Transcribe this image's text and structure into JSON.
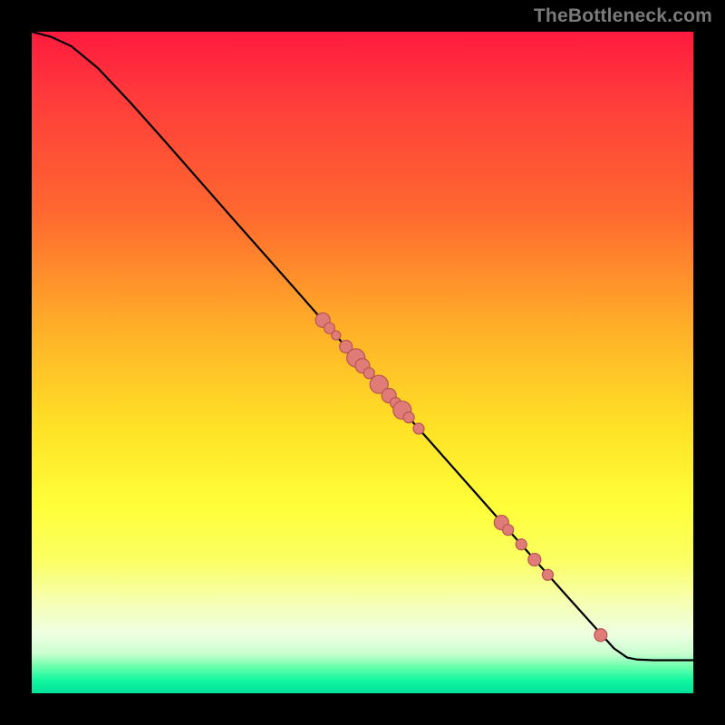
{
  "watermark": {
    "text": "TheBottleneck.com"
  },
  "colors": {
    "dot_fill": "#e07c78",
    "dot_stroke": "#b85550",
    "curve": "#000000",
    "frame_bg": "#000000"
  },
  "chart_data": {
    "type": "line",
    "title": "",
    "xlabel": "",
    "ylabel": "",
    "xlim": [
      0,
      100
    ],
    "ylim": [
      0,
      100
    ],
    "grid": false,
    "curve": [
      {
        "x": 0,
        "y": 100
      },
      {
        "x": 3,
        "y": 99.2
      },
      {
        "x": 6,
        "y": 97.8
      },
      {
        "x": 10,
        "y": 94.5
      },
      {
        "x": 15,
        "y": 89.2
      },
      {
        "x": 20,
        "y": 83.6
      },
      {
        "x": 30,
        "y": 72.2
      },
      {
        "x": 40,
        "y": 60.9
      },
      {
        "x": 50,
        "y": 49.5
      },
      {
        "x": 60,
        "y": 38.3
      },
      {
        "x": 70,
        "y": 27.0
      },
      {
        "x": 80,
        "y": 15.7
      },
      {
        "x": 88,
        "y": 6.8
      },
      {
        "x": 90,
        "y": 5.4
      },
      {
        "x": 91.5,
        "y": 5.1
      },
      {
        "x": 94,
        "y": 5.0
      },
      {
        "x": 100,
        "y": 5.0
      }
    ],
    "points": [
      {
        "x": 44.0,
        "y": 56.4,
        "r": 8
      },
      {
        "x": 45.0,
        "y": 55.2,
        "r": 6
      },
      {
        "x": 46.0,
        "y": 54.1,
        "r": 5
      },
      {
        "x": 47.5,
        "y": 52.4,
        "r": 7
      },
      {
        "x": 49.0,
        "y": 50.7,
        "r": 10
      },
      {
        "x": 50.0,
        "y": 49.5,
        "r": 8
      },
      {
        "x": 51.0,
        "y": 48.4,
        "r": 6
      },
      {
        "x": 52.5,
        "y": 46.7,
        "r": 10
      },
      {
        "x": 54.0,
        "y": 45.0,
        "r": 8
      },
      {
        "x": 55.0,
        "y": 43.9,
        "r": 6
      },
      {
        "x": 56.0,
        "y": 42.8,
        "r": 10
      },
      {
        "x": 57.0,
        "y": 41.7,
        "r": 6
      },
      {
        "x": 58.5,
        "y": 40.0,
        "r": 6
      },
      {
        "x": 71.0,
        "y": 25.8,
        "r": 8
      },
      {
        "x": 72.0,
        "y": 24.7,
        "r": 6
      },
      {
        "x": 74.0,
        "y": 22.5,
        "r": 6
      },
      {
        "x": 76.0,
        "y": 20.2,
        "r": 7
      },
      {
        "x": 78.0,
        "y": 17.9,
        "r": 6
      },
      {
        "x": 86.0,
        "y": 8.8,
        "r": 7
      }
    ]
  }
}
